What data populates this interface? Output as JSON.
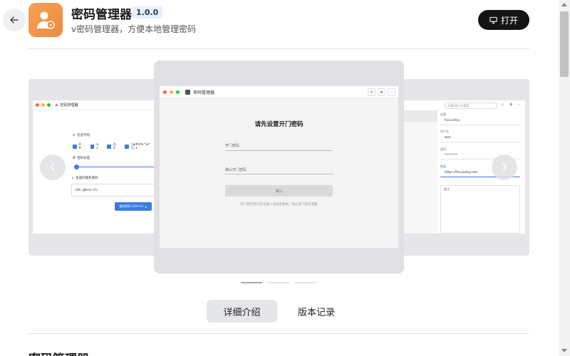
{
  "header": {
    "app_name": "密码管理器",
    "version": "1.0.0",
    "description": "v密码管理器，方便本地管理密码",
    "open_label": "打开"
  },
  "carousel": {
    "center": {
      "window_title": "密码管理器",
      "heading": "请先设置开门密码",
      "field1": "开门密码",
      "field2": "确认开门密码",
      "confirm": "确认",
      "hint": "开门密码用于验证进入该加密数据，防止开门密码泄露"
    },
    "left": {
      "window_title": "密码管理器",
      "section_chars": "包含字符",
      "chk_09": "0-9",
      "chk_az": "a-z",
      "chk_AZ": "A-Z",
      "chk_sym": "!@#$%^&*()_+",
      "section_len": "密码长度",
      "section_gen": "生成的随机密码",
      "generated": "v9h_@8e$r(A)",
      "copy_btn": "复制密码 (Ctrl+C)"
    },
    "right": {
      "search_placeholder": "标题/用户名搜索",
      "label_title": "标题",
      "val_title": "FocusAny",
      "label_user": "用户名",
      "val_user": "test",
      "label_pass": "密码",
      "val_pass": "•••••••",
      "label_url": "链接",
      "val_url": "https://focusany.com",
      "label_note": "备注"
    },
    "indicator_count": 3,
    "active_index": 0
  },
  "tabs": {
    "detail": "详细介绍",
    "history": "版本记录"
  },
  "section_title": "密码管理器",
  "colors": {
    "icon_bg": "#ef8a3a",
    "open_btn_bg": "#141414",
    "accent_blue": "#3d7be0"
  }
}
